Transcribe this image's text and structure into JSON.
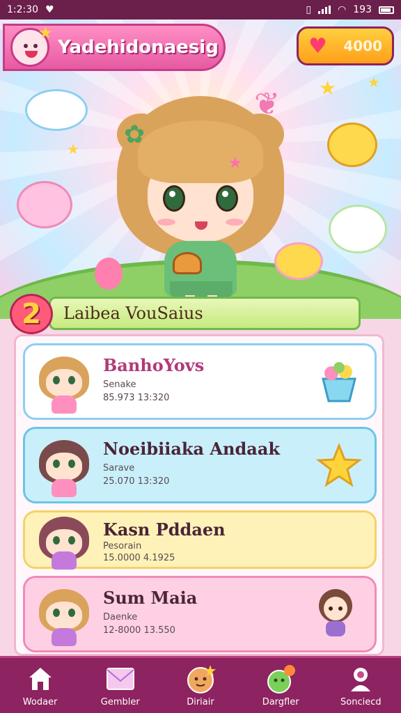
{
  "status_bar": {
    "time": "1:2:30",
    "battery": "193"
  },
  "header": {
    "title": "Yadehidonaesig",
    "currency": "4000"
  },
  "level_banner": {
    "level": "2",
    "title": "Laibea VouSaius"
  },
  "players": [
    {
      "name": "BanhoYovs",
      "name_color": "#b03a7a",
      "role": "Senake",
      "score": "85.973 13:320",
      "card_bg": "#ffffff",
      "card_border": "#8ccff0",
      "hair": "#d9a35c",
      "outfit": "#ff8fbf",
      "badge": "cupcake-icon"
    },
    {
      "name": "Noeibiiaka Andaak",
      "name_color": "#4a2438",
      "role": "Sarave",
      "score": "25.070 13:320",
      "card_bg": "#c9f0fa",
      "card_border": "#6cc4e6",
      "hair": "#7a4a4a",
      "outfit": "#ff8fbf",
      "badge": "star-icon"
    },
    {
      "name": "Kasn Pddaen",
      "name_color": "#4a2438",
      "role": "Pesorain",
      "score": "15.0000 4.1925",
      "card_bg": "#fff2b8",
      "card_border": "#f2d36a",
      "hair": "#8a4a5a",
      "outfit": "#c47adb",
      "badge": ""
    },
    {
      "name": "Sum Maia",
      "name_color": "#4a2438",
      "role": "Daenke",
      "score": "12-8000 13.550",
      "card_bg": "#ffd0e4",
      "card_border": "#f08ab8",
      "hair": "#d9a35c",
      "outfit": "#c47adb",
      "badge": "chibi-icon"
    }
  ],
  "nav": [
    {
      "label": "Wodaer",
      "icon": "home-icon"
    },
    {
      "label": "Gembler",
      "icon": "mail-icon"
    },
    {
      "label": "Diriair",
      "icon": "character-icon"
    },
    {
      "label": "Dargfler",
      "icon": "slime-icon"
    },
    {
      "label": "Sonciecd",
      "icon": "profile-icon"
    }
  ]
}
